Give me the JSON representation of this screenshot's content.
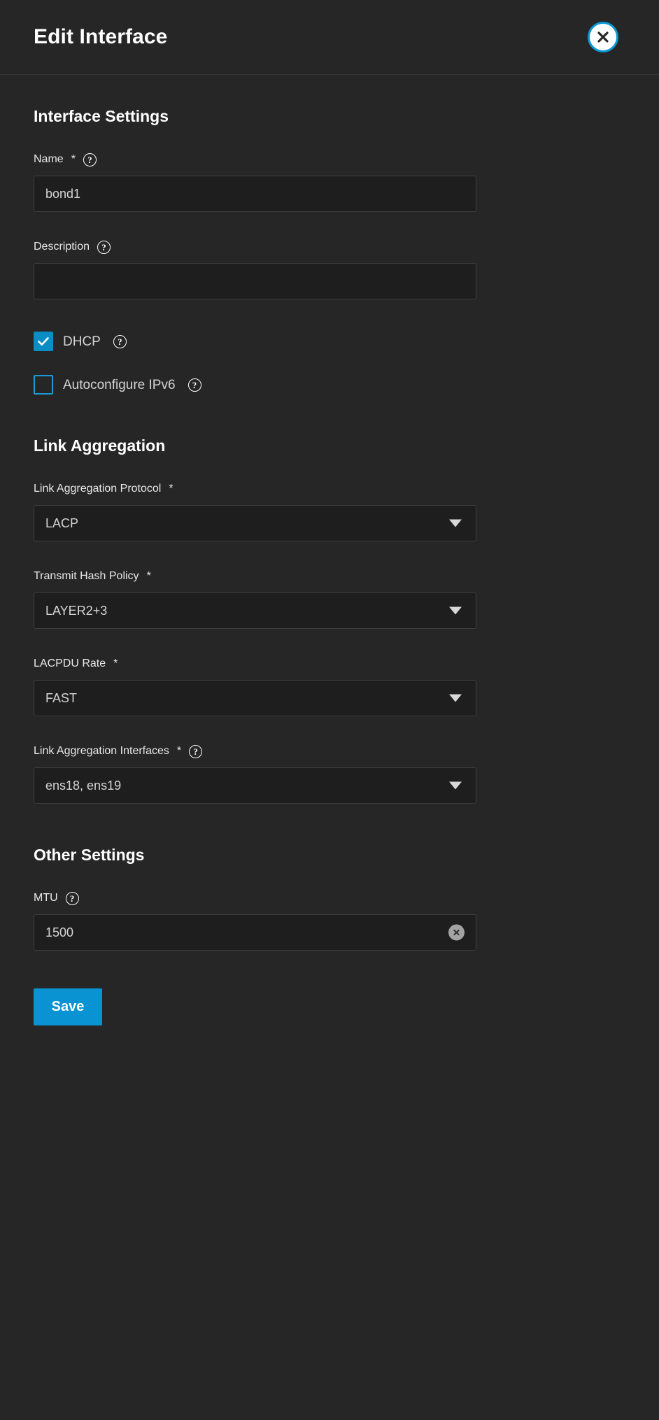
{
  "header": {
    "title": "Edit Interface",
    "close_icon": "close-icon"
  },
  "sections": {
    "interface_settings": {
      "title": "Interface Settings",
      "name_field": {
        "label": "Name",
        "required_marker": "*",
        "help_icon": "?",
        "value": "bond1"
      },
      "description_field": {
        "label": "Description",
        "help_icon": "?",
        "value": ""
      },
      "dhcp_checkbox": {
        "label": "DHCP",
        "help_icon": "?",
        "checked": true
      },
      "autoconfigure_ipv6_checkbox": {
        "label": "Autoconfigure IPv6",
        "help_icon": "?",
        "checked": false
      }
    },
    "link_aggregation": {
      "title": "Link Aggregation",
      "protocol_field": {
        "label": "Link Aggregation Protocol",
        "required_marker": "*",
        "value": "LACP"
      },
      "hash_policy_field": {
        "label": "Transmit Hash Policy",
        "required_marker": "*",
        "value": "LAYER2+3"
      },
      "lacpdu_rate_field": {
        "label": "LACPDU Rate",
        "required_marker": "*",
        "value": "FAST"
      },
      "interfaces_field": {
        "label": "Link Aggregation Interfaces",
        "required_marker": "*",
        "help_icon": "?",
        "value": "ens18, ens19"
      }
    },
    "other_settings": {
      "title": "Other Settings",
      "mtu_field": {
        "label": "MTU",
        "help_icon": "?",
        "value": "1500",
        "clear_icon": "clear-icon"
      }
    }
  },
  "footer": {
    "save_label": "Save"
  },
  "colors": {
    "background": "#262626",
    "control_background": "#1e1e1e",
    "control_border": "#3d3d3d",
    "accent_blue": "#0a93d2",
    "checkbox_blue": "#0a8cc4",
    "checkbox_outline_blue": "#1e9bd7",
    "focus_ring": "#0a99d6",
    "text_primary": "#ffffff",
    "text_secondary": "#d4d4d4"
  }
}
